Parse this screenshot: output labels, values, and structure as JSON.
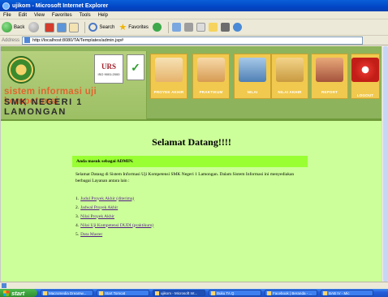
{
  "window": {
    "title": "ujikom - Microsoft Internet Explorer"
  },
  "menubar": {
    "items": [
      "File",
      "Edit",
      "View",
      "Favorites",
      "Tools",
      "Help"
    ]
  },
  "toolbar": {
    "back_label": "Back",
    "search_label": "Search",
    "favorites_label": "Favorites"
  },
  "address": {
    "label": "Address",
    "url": "http://localhost:8080/TA/Templates/admin.jsp#"
  },
  "header": {
    "site_title": "sistem informasi uji kompetensi",
    "site_subtitle": "SMK NEGERI 1 LAMONGAN",
    "urs_text": "URS",
    "iso_text": "ISO 9001:2000",
    "nav": [
      {
        "label": "PROYEK AKHIR",
        "icon": "proyek-akhir-icon"
      },
      {
        "label": "PRAKTIKUM",
        "icon": "praktikum-icon"
      },
      {
        "label": "NILAI",
        "icon": "nilai-icon"
      },
      {
        "label": "NILAI AKHIR",
        "icon": "nilai-akhir-icon"
      },
      {
        "label": "REPORT",
        "icon": "report-icon"
      },
      {
        "label": "LOGOUT",
        "icon": "power-icon"
      }
    ]
  },
  "content": {
    "welcome": "Selamat Datang!!!!",
    "login_note": "Anda masuk sebagai ADMIN.",
    "intro": "Selamat Datang di Sistem Informasi Uji Kompetensi SMK Negeri 1 Lamongan. Dalam Sistem Informasi ini menyediakan berbagai Layanan antara lain :",
    "menu": [
      {
        "num": "1.",
        "label": "Judul Proyek Akhir (diterima)"
      },
      {
        "num": "2.",
        "label": "Jadwal Proyek Akhir"
      },
      {
        "num": "3.",
        "label": "Nilai Proyek Akhir"
      },
      {
        "num": "4.",
        "label": "Nilai Uji Kompetensi DUDI (praktikum)"
      },
      {
        "num": "5.",
        "label": "Data Master"
      }
    ]
  },
  "taskbar": {
    "start_label": "start",
    "tasks": [
      "Macromedia Dreamw...",
      "Start Tomcat",
      "ujikom - Microsoft Int...",
      "Buku TA Q",
      "Facebook | Beranda - ...",
      "BAB IV - Mic"
    ]
  },
  "colors": {
    "page_bg": "#ccff99",
    "header_bg": "#8db35c",
    "highlight": "#99ff33",
    "nav_button": "#f1c94e"
  }
}
